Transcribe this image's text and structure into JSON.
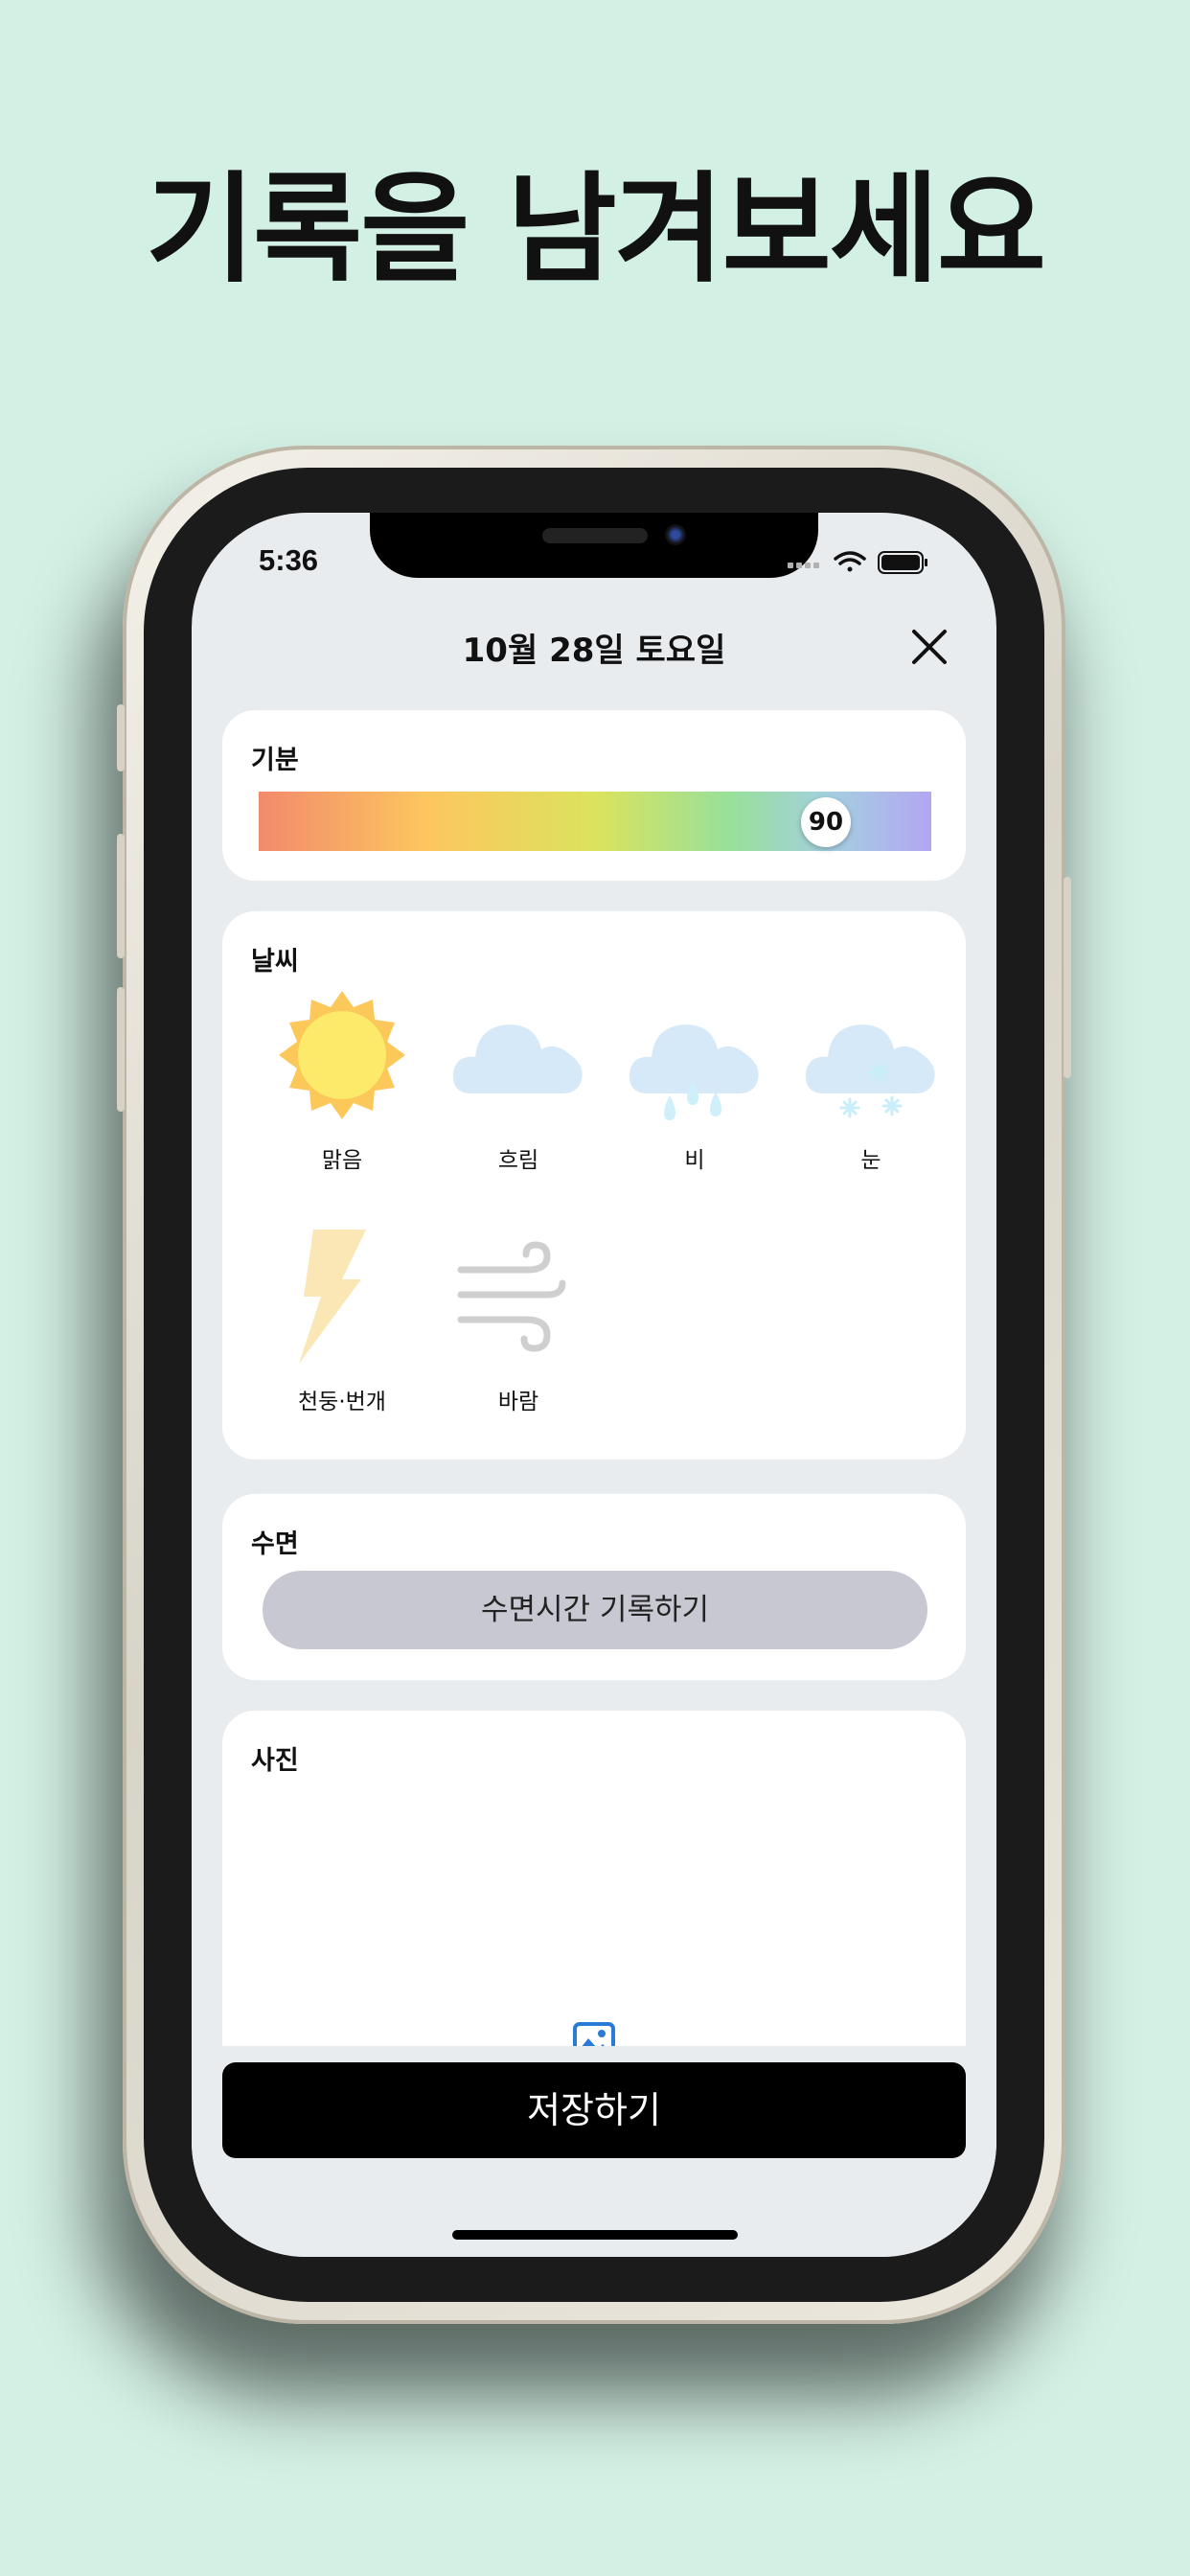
{
  "headline": "기록을 남겨보세요",
  "status_bar": {
    "time": "5:36"
  },
  "nav": {
    "title": "10월 28일 토요일"
  },
  "mood": {
    "title": "기분",
    "value": "90",
    "level_percent": 90
  },
  "weather": {
    "title": "날씨",
    "options": [
      {
        "label": "맑음",
        "icon": "sun-icon"
      },
      {
        "label": "흐림",
        "icon": "cloud-icon"
      },
      {
        "label": "비",
        "icon": "rain-icon"
      },
      {
        "label": "눈",
        "icon": "snow-icon"
      },
      {
        "label": "천둥·번개",
        "icon": "lightning-icon"
      },
      {
        "label": "바람",
        "icon": "wind-icon"
      }
    ]
  },
  "sleep": {
    "title": "수면",
    "button_label": "수면시간 기록하기"
  },
  "photo": {
    "title": "사진",
    "icon": "image-icon"
  },
  "save": {
    "label": "저장하기"
  },
  "colors": {
    "background": "#d3f0e4",
    "mood_knob": "#ffffff",
    "save_button": "#000000"
  }
}
